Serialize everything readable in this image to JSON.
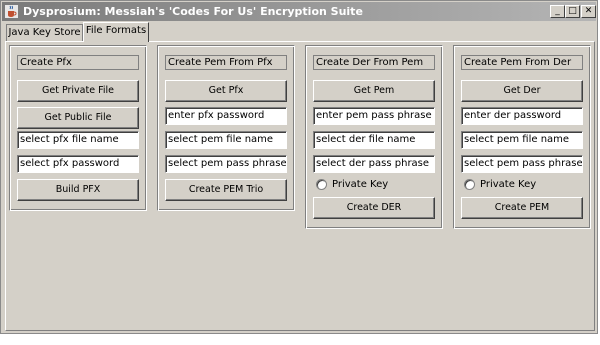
{
  "window": {
    "title": "Dysprosium: Messiah's 'Codes For Us' Encryption Suite",
    "app_icon": "java-cup-icon",
    "minimize": "_",
    "maximize": "□",
    "close": "✕"
  },
  "tabs": [
    {
      "label": "Java Key Store",
      "active": false
    },
    {
      "label": "File Formats",
      "active": true
    }
  ],
  "panels": {
    "create_pfx": {
      "title": "Create Pfx",
      "get_private_file": "Get Private File",
      "get_public_file": "Get Public File",
      "pfx_file_name": "select pfx file name",
      "pfx_password": "select pfx password",
      "build_pfx": "Build PFX"
    },
    "create_pem_from_pfx": {
      "title": "Create Pem From Pfx",
      "get_pfx": "Get Pfx",
      "pfx_password": "enter pfx password",
      "pem_file_name": "select pem file name",
      "pem_pass_phrase": "select pem pass phrase",
      "create_pem_trio": "Create PEM Trio"
    },
    "create_der_from_pem": {
      "title": "Create Der From Pem",
      "get_pem": "Get Pem",
      "pem_pass_phrase": "enter pem pass phrase",
      "der_file_name": "select der file name",
      "der_pass_phrase": "select der pass phrase",
      "private_key": "Private Key",
      "create_der": "Create DER"
    },
    "create_pem_from_der": {
      "title": "Create Pem From Der",
      "get_der": "Get Der",
      "der_password": "enter der password",
      "pem_file_name": "select pem file name",
      "pem_pass_phrase": "select pem pass phrase",
      "private_key": "Private Key",
      "create_pem": "Create PEM"
    }
  }
}
